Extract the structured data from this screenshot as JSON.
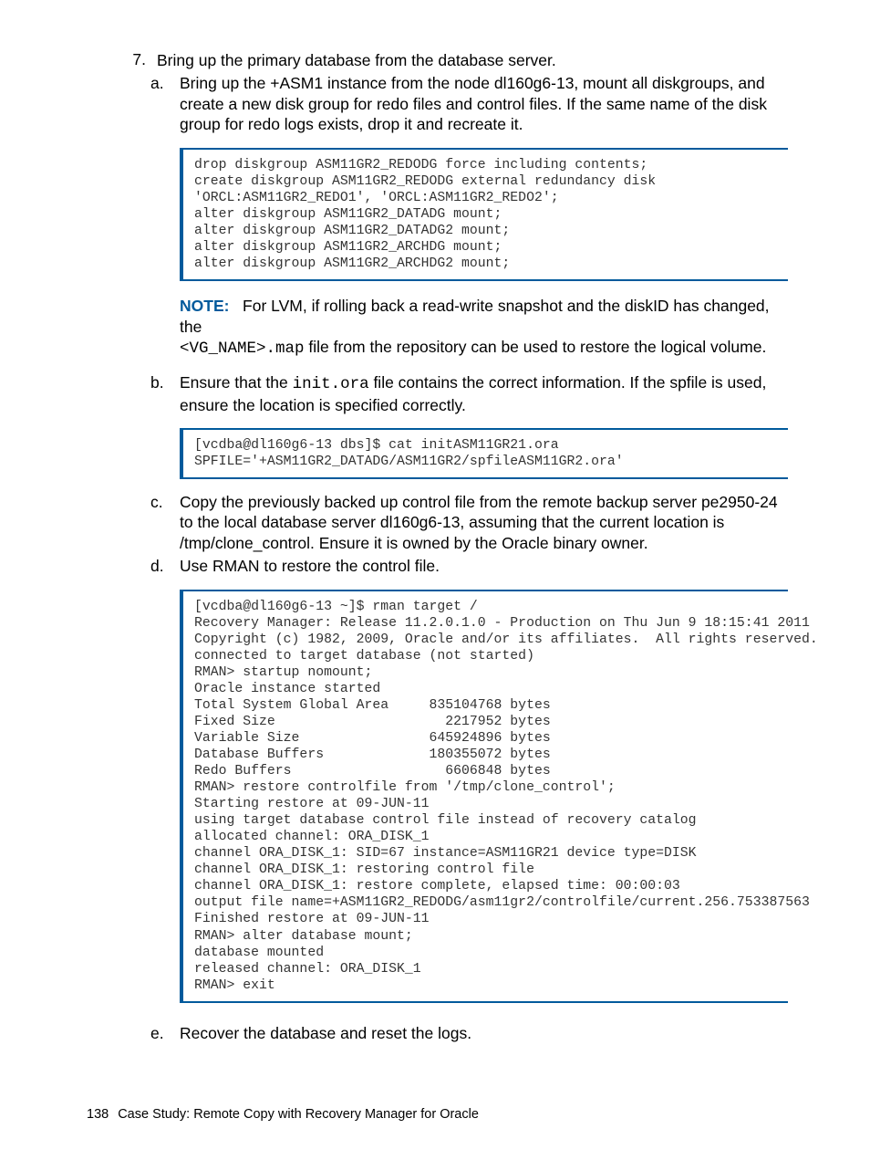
{
  "step7": {
    "number": "7.",
    "text": "Bring up the primary database from the database server.",
    "a_letter": "a.",
    "a_text": "Bring up the +ASM1 instance from the node dl160g6-13, mount all diskgroups, and create a new disk group for redo files and control files. If the same name of the disk group for redo logs exists, drop it and recreate it.",
    "code_a": "drop diskgroup ASM11GR2_REDODG force including contents;\ncreate diskgroup ASM11GR2_REDODG external redundancy disk\n'ORCL:ASM11GR2_REDO1', 'ORCL:ASM11GR2_REDO2';\nalter diskgroup ASM11GR2_DATADG mount;\nalter diskgroup ASM11GR2_DATADG2 mount;\nalter diskgroup ASM11GR2_ARCHDG mount;\nalter diskgroup ASM11GR2_ARCHDG2 mount;",
    "note_label": "NOTE:",
    "note_text_1": "For LVM, if rolling back a read-write snapshot and the diskID has changed, the",
    "note_mono": "<VG_NAME>.map",
    "note_text_2": " file from the repository can be used to restore the logical volume.",
    "b_letter": "b.",
    "b_text_1": "Ensure that the ",
    "b_mono": "init.ora",
    "b_text_2": " file contains the correct information. If the spfile is used, ensure the location is specified correctly.",
    "code_b": "[vcdba@dl160g6-13 dbs]$ cat initASM11GR21.ora\nSPFILE='+ASM11GR2_DATADG/ASM11GR2/spfileASM11GR2.ora'",
    "c_letter": "c.",
    "c_text": "Copy the previously backed up control file from the remote backup server pe2950-24 to the local database server dl160g6-13, assuming that the current location is /tmp/clone_control. Ensure it is owned by the Oracle binary owner.",
    "d_letter": "d.",
    "d_text": "Use RMAN to restore the control file.",
    "code_d": "[vcdba@dl160g6-13 ~]$ rman target /\nRecovery Manager: Release 11.2.0.1.0 - Production on Thu Jun 9 18:15:41 2011\nCopyright (c) 1982, 2009, Oracle and/or its affiliates.  All rights reserved.\nconnected to target database (not started)\nRMAN> startup nomount;\nOracle instance started\nTotal System Global Area     835104768 bytes\nFixed Size                     2217952 bytes\nVariable Size                645924896 bytes\nDatabase Buffers             180355072 bytes\nRedo Buffers                   6606848 bytes\nRMAN> restore controlfile from '/tmp/clone_control';\nStarting restore at 09-JUN-11\nusing target database control file instead of recovery catalog\nallocated channel: ORA_DISK_1\nchannel ORA_DISK_1: SID=67 instance=ASM11GR21 device type=DISK\nchannel ORA_DISK_1: restoring control file\nchannel ORA_DISK_1: restore complete, elapsed time: 00:00:03\noutput file name=+ASM11GR2_REDODG/asm11gr2/controlfile/current.256.753387563\nFinished restore at 09-JUN-11\nRMAN> alter database mount;\ndatabase mounted\nreleased channel: ORA_DISK_1\nRMAN> exit",
    "e_letter": "e.",
    "e_text": "Recover the database and reset the logs."
  },
  "footer": {
    "pagenum": "138",
    "chapter": "Case Study: Remote Copy with Recovery Manager for Oracle"
  }
}
